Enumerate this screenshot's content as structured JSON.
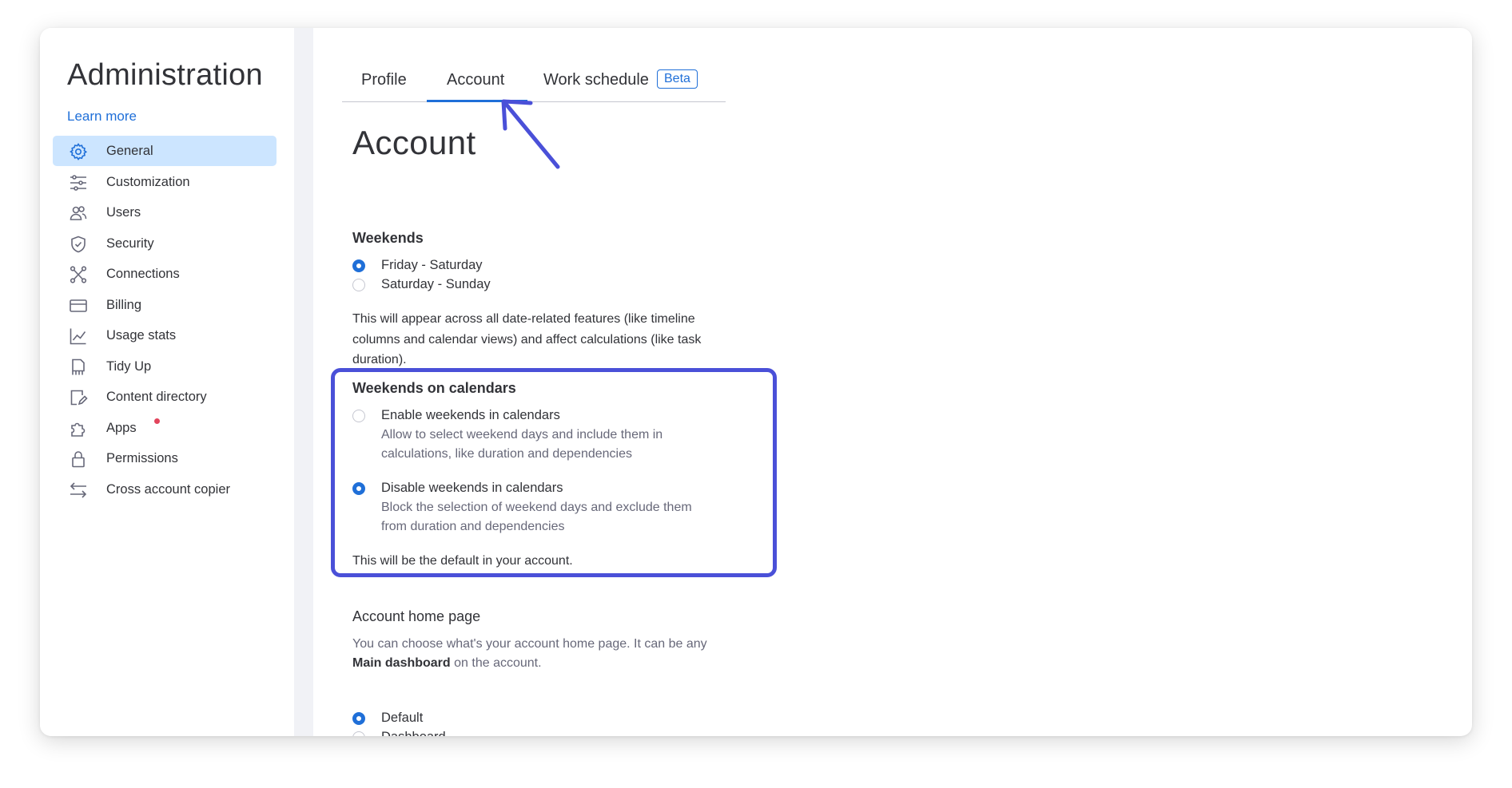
{
  "sidebar": {
    "title": "Administration",
    "learn_more": "Learn more",
    "items": [
      {
        "label": "General",
        "icon": "gear-icon",
        "active": true
      },
      {
        "label": "Customization",
        "icon": "sliders-icon"
      },
      {
        "label": "Users",
        "icon": "users-icon"
      },
      {
        "label": "Security",
        "icon": "shield-icon"
      },
      {
        "label": "Connections",
        "icon": "connections-icon"
      },
      {
        "label": "Billing",
        "icon": "credit-card-icon"
      },
      {
        "label": "Usage stats",
        "icon": "chart-icon"
      },
      {
        "label": "Tidy Up",
        "icon": "tidy-up-icon"
      },
      {
        "label": "Content directory",
        "icon": "content-directory-icon"
      },
      {
        "label": "Apps",
        "icon": "puzzle-icon",
        "notification_dot": true
      },
      {
        "label": "Permissions",
        "icon": "lock-icon"
      },
      {
        "label": "Cross account copier",
        "icon": "swap-arrows-icon"
      }
    ]
  },
  "tabs": [
    {
      "label": "Profile"
    },
    {
      "label": "Account",
      "active": true
    },
    {
      "label": "Work schedule",
      "badge": "Beta"
    }
  ],
  "page_title": "Account",
  "weekends": {
    "title": "Weekends",
    "options": [
      {
        "label": "Friday - Saturday",
        "checked": true
      },
      {
        "label": "Saturday - Sunday",
        "checked": false
      }
    ],
    "description_lines": [
      "This will appear across all date-related features (like timeline",
      "columns and calendar views) and affect calculations (like task",
      "duration)."
    ]
  },
  "weekends_on_calendars": {
    "title": "Weekends on calendars",
    "options": [
      {
        "label": "Enable weekends in calendars",
        "checked": false,
        "sub_lines": [
          "Allow to select weekend days and include them in",
          "calculations, like duration and dependencies"
        ]
      },
      {
        "label": "Disable weekends in calendars",
        "checked": true,
        "sub_lines": [
          "Block the selection of weekend days and exclude them",
          "from duration and dependencies"
        ]
      }
    ],
    "footer": "This will be the default in your account."
  },
  "account_home_page": {
    "title": "Account home page",
    "desc_line1": "You can choose what's your account home page. It can be any",
    "desc_bold": "Main dashboard",
    "desc_rest": " on the account.",
    "options": [
      {
        "label": "Default",
        "checked": true
      },
      {
        "label": "Dashboard",
        "checked": false
      }
    ]
  },
  "colors": {
    "accent": "#1f6fd8",
    "highlight_border": "#4a50d8",
    "active_nav_bg": "#cce5ff"
  }
}
